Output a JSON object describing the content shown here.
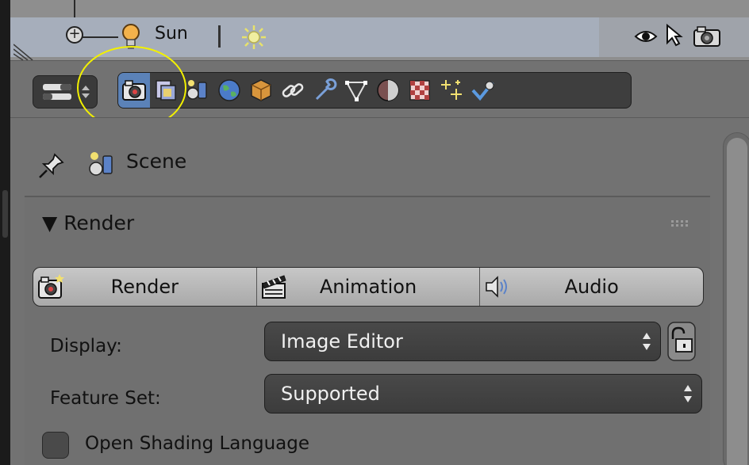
{
  "outliner": {
    "object_label": "Sun",
    "icons": [
      "expand-icon",
      "lamp-icon",
      "sun-lamp-icon",
      "eye-icon",
      "cursor-icon",
      "render-camera-icon"
    ]
  },
  "properties": {
    "tabs": [
      {
        "name": "render",
        "icon": "camera-icon",
        "active": true
      },
      {
        "name": "render-layers",
        "icon": "render-layers-icon",
        "active": false
      },
      {
        "name": "scene",
        "icon": "scene-icon",
        "active": false
      },
      {
        "name": "world",
        "icon": "world-icon",
        "active": false
      },
      {
        "name": "object",
        "icon": "cube-icon",
        "active": false
      },
      {
        "name": "constraints",
        "icon": "link-icon",
        "active": false
      },
      {
        "name": "modifiers",
        "icon": "wrench-icon",
        "active": false
      },
      {
        "name": "data",
        "icon": "vertex-icon",
        "active": false
      },
      {
        "name": "material",
        "icon": "material-sphere-icon",
        "active": false
      },
      {
        "name": "texture",
        "icon": "checker-icon",
        "active": false
      },
      {
        "name": "particles",
        "icon": "sparkles-icon",
        "active": false
      },
      {
        "name": "physics",
        "icon": "physics-icon",
        "active": false
      }
    ],
    "context_label": "Scene",
    "panel_title": "Render",
    "panel_toggle": "▼",
    "buttons": {
      "render": "Render",
      "animation": "Animation",
      "audio": "Audio"
    },
    "display": {
      "label": "Display:",
      "value": "Image Editor"
    },
    "feature_set": {
      "label": "Feature Set:",
      "value": "Supported"
    },
    "osl": {
      "label": "Open Shading Language",
      "checked": false
    },
    "accent": "#5b82b8",
    "highlight_color": "#f2f000"
  }
}
